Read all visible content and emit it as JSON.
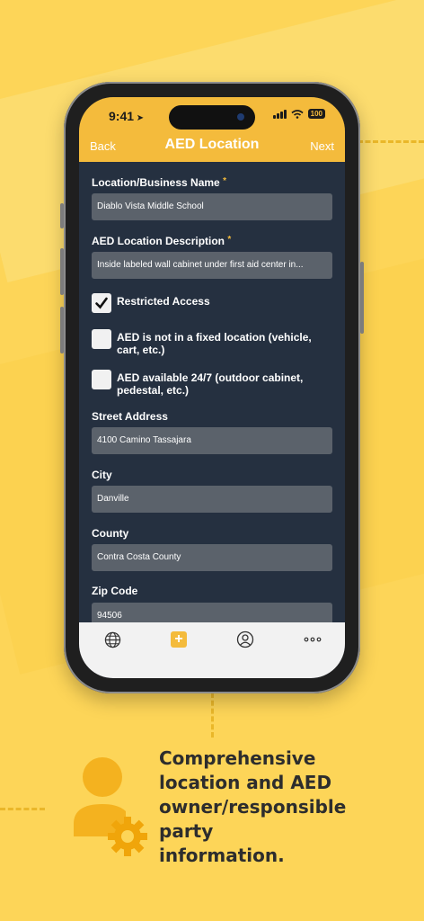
{
  "status": {
    "time": "9:41",
    "battery": "100"
  },
  "nav": {
    "back": "Back",
    "title": "AED Location",
    "next": "Next"
  },
  "form": {
    "location_name_label": "Location/Business Name",
    "location_name_value": "Diablo Vista Middle School",
    "description_label": "AED Location Description",
    "description_value": "Inside labeled wall cabinet under first aid center in...",
    "required_mark": "*",
    "restricted_access": {
      "label": "Restricted Access",
      "checked": true
    },
    "not_fixed_location": {
      "label": "AED is not in a fixed location (vehicle, cart, etc.)",
      "checked": false
    },
    "available_24_7": {
      "label": "AED available 24/7 (outdoor cabinet, pedestal, etc.)",
      "checked": false
    },
    "street_label": "Street Address",
    "street_value": "4100 Camino Tassajara",
    "city_label": "City",
    "city_value": "Danville",
    "county_label": "County",
    "county_value": "Contra Costa County",
    "zip_label": "Zip Code",
    "zip_value": "94506"
  },
  "tabs": [
    {
      "icon": "globe-icon"
    },
    {
      "icon": "plus-icon"
    },
    {
      "icon": "profile-icon"
    },
    {
      "icon": "more-icon"
    }
  ],
  "caption": "Comprehensive location and AED owner/responsible party information.",
  "colors": {
    "accent": "#f4bb3c",
    "background": "#fdd558",
    "form_bg": "#253040",
    "field_bg": "#5b626b"
  }
}
